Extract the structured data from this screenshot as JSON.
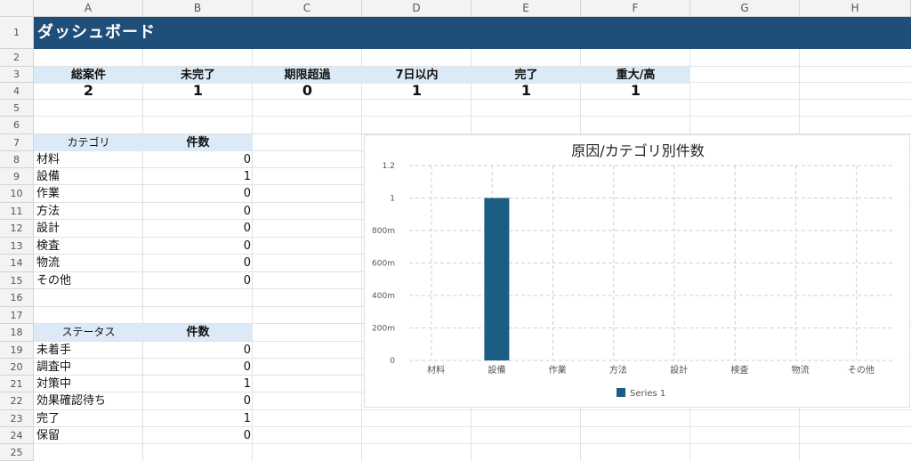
{
  "columns": [
    "A",
    "B",
    "C",
    "D",
    "E",
    "F",
    "G",
    "H"
  ],
  "rows": [
    "1",
    "2",
    "3",
    "4",
    "5",
    "6",
    "7",
    "8",
    "9",
    "10",
    "11",
    "12",
    "13",
    "14",
    "15",
    "16",
    "17",
    "18",
    "19",
    "20",
    "21",
    "22",
    "23",
    "24",
    "25"
  ],
  "dashboard": {
    "title": "ダッシュボード"
  },
  "kpis": [
    {
      "label": "総案件",
      "value": "2"
    },
    {
      "label": "未完了",
      "value": "1"
    },
    {
      "label": "期限超過",
      "value": "0"
    },
    {
      "label": "7日以内",
      "value": "1"
    },
    {
      "label": "完了",
      "value": "1"
    },
    {
      "label": "重大/高",
      "value": "1"
    }
  ],
  "category_table": {
    "header_label": "カテゴリ",
    "header_count": "件数",
    "rows": [
      {
        "label": "材料",
        "count": "0"
      },
      {
        "label": "設備",
        "count": "1"
      },
      {
        "label": "作業",
        "count": "0"
      },
      {
        "label": "方法",
        "count": "0"
      },
      {
        "label": "設計",
        "count": "0"
      },
      {
        "label": "検査",
        "count": "0"
      },
      {
        "label": "物流",
        "count": "0"
      },
      {
        "label": "その他",
        "count": "0"
      }
    ]
  },
  "status_table": {
    "header_label": "ステータス",
    "header_count": "件数",
    "rows": [
      {
        "label": "未着手",
        "count": "0"
      },
      {
        "label": "調査中",
        "count": "0"
      },
      {
        "label": "対策中",
        "count": "1"
      },
      {
        "label": "効果確認待ち",
        "count": "0"
      },
      {
        "label": "完了",
        "count": "1"
      },
      {
        "label": "保留",
        "count": "0"
      }
    ]
  },
  "colors": {
    "title_band": "#1f4e79",
    "header_fill": "#dbeaf6",
    "bar": "#1a5e83"
  },
  "chart_data": {
    "type": "bar",
    "title": "原因/カテゴリ別件数",
    "categories": [
      "材料",
      "設備",
      "作業",
      "方法",
      "設計",
      "検査",
      "物流",
      "その他"
    ],
    "series": [
      {
        "name": "Series 1",
        "values": [
          0,
          1,
          0,
          0,
          0,
          0,
          0,
          0
        ]
      }
    ],
    "ylim": [
      0,
      1.2
    ],
    "yticks": [
      "0",
      "200m",
      "400m",
      "600m",
      "800m",
      "1",
      "1.2"
    ],
    "grid": true,
    "legend": "bottom"
  }
}
